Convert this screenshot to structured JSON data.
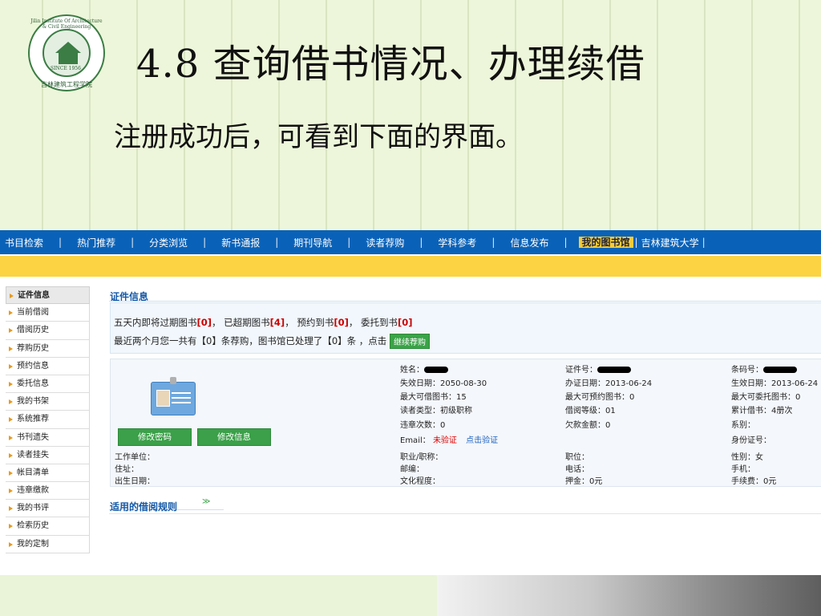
{
  "slide": {
    "title": "4.8 查询借书情况、办理续借",
    "subtitle": "注册成功后，可看到下面的界面。",
    "logo": {
      "top_text": "Jilin Institute Of Architecture & Civil Engineering",
      "since": "SINCE 1956",
      "bottom_text": "吉林建筑工程学院"
    }
  },
  "nav": {
    "items": [
      "书目检索",
      "热门推荐",
      "分类浏览",
      "新书通报",
      "期刊导航",
      "读者荐购",
      "学科参考",
      "信息发布"
    ],
    "separator": "|",
    "active": "我的图书馆",
    "tail": "吉林建筑大学"
  },
  "sidebar": {
    "items": [
      "证件信息",
      "当前借阅",
      "借阅历史",
      "荐购历史",
      "预约信息",
      "委托信息",
      "我的书架",
      "系统推荐",
      "书刊遗失",
      "读者挂失",
      "帐目清单",
      "违章缴款",
      "我的书评",
      "检索历史",
      "我的定制"
    ]
  },
  "main": {
    "section_title": "证件信息",
    "notice": {
      "l1_a": "五天内即将过期图书",
      "l1_a_val": "[0]",
      "l1_b": "，  已超期图书",
      "l1_b_val": "[4]",
      "l1_c": "，  预约到书",
      "l1_c_val": "[0]",
      "l1_d": "，  委托到书",
      "l1_d_val": "[0]",
      "l2_text": "最近两个月您一共有【0】条荐购，图书馆已处理了【0】条 ，点击",
      "l2_button": "继续荐购"
    },
    "buttons": {
      "change_password": "修改密码",
      "change_info": "修改信息"
    },
    "left_fields": {
      "work": "工作单位：",
      "address": "住址：",
      "birth": "出生日期："
    },
    "col1": {
      "name": "姓名：",
      "expire": "失效日期：2050-08-30",
      "max_borrow": "最大可借图书：15",
      "reader_type": "读者类型：初级职称",
      "violations": "违章次数：0",
      "email_label": "Email：",
      "email_status": "未验证",
      "email_link": "点击验证",
      "job": "职业/职称：",
      "zip": "邮编：",
      "education": "文化程度："
    },
    "col2": {
      "card_no": "证件号：",
      "issue_date": "办证日期：2013-06-24",
      "max_reserve": "最大可预约图书：0",
      "borrow_level": "借阅等级：01",
      "debt": "欠款金额：0",
      "position": "职位：",
      "phone": "电话：",
      "deposit": "押金：0元"
    },
    "col3": {
      "barcode": "条码号：",
      "effective": "生效日期：2013-06-24",
      "max_entrust": "最大可委托图书：0",
      "total_borrow": "累计借书：4册次",
      "department": "系别：",
      "id_no": "身份证号：",
      "gender": "性别：女",
      "mobile": "手机：",
      "fee": "手续费：0元"
    },
    "rules_title": "适用的借阅规则",
    "rules_chevron": "≫"
  },
  "colors": {
    "nav_bg": "#0a62b8",
    "yellow_bar": "#fbd343",
    "accent_green": "#3aa447",
    "title_blue": "#155aa8"
  }
}
